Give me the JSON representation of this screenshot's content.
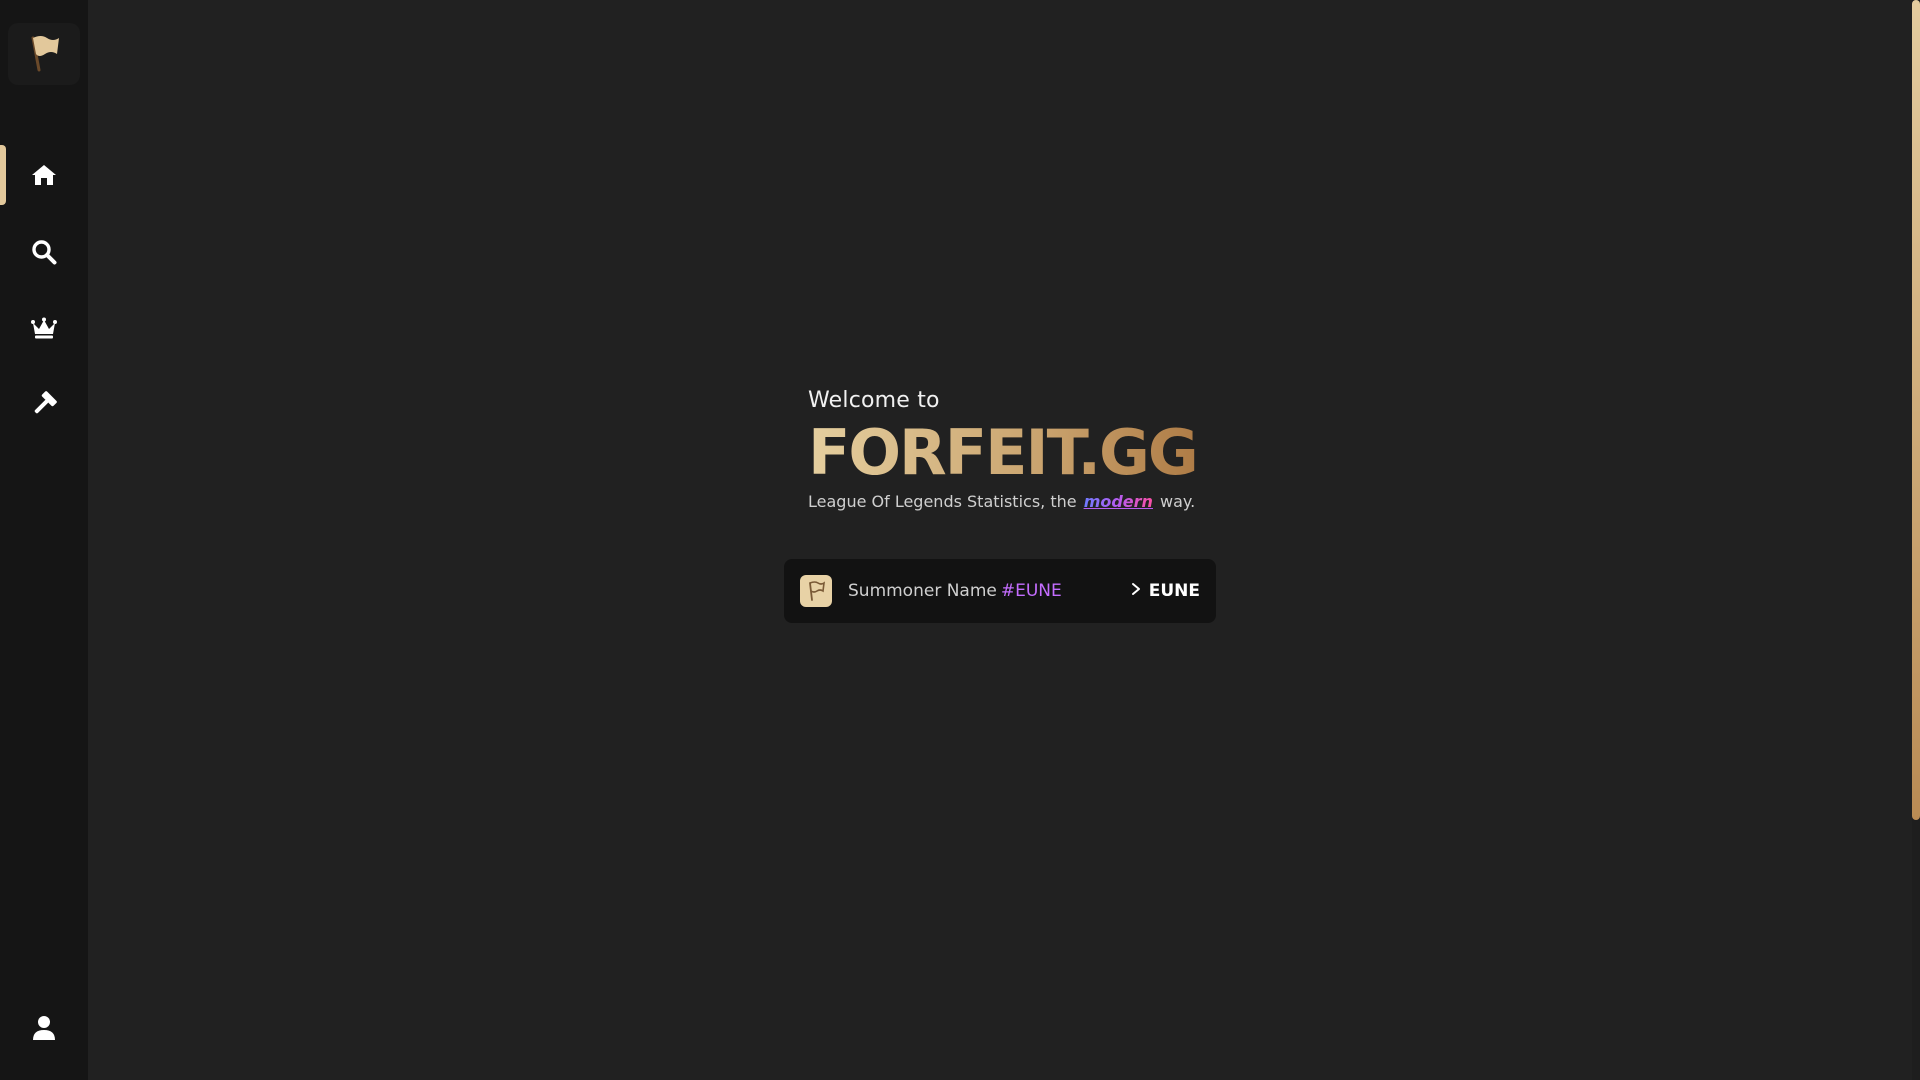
{
  "brand": {
    "welcome": "Welcome to",
    "name": "FORFEIT.GG",
    "tagline_before": "League Of Legends Statistics, the",
    "tagline_highlight": "modern",
    "tagline_after": "way."
  },
  "sidebar": {
    "logo_icon": "flag-icon",
    "items": [
      {
        "name": "home",
        "icon": "home-icon",
        "active": true
      },
      {
        "name": "search",
        "icon": "search-icon",
        "active": false
      },
      {
        "name": "leaderboard",
        "icon": "crown-icon",
        "active": false
      },
      {
        "name": "tools",
        "icon": "hammer-icon",
        "active": false
      }
    ],
    "bottom_item": {
      "name": "profile",
      "icon": "user-icon"
    }
  },
  "search": {
    "placeholder_name": "Summoner Name",
    "placeholder_tag": "#EUNE",
    "region": "EUNE",
    "avatar_icon": "flag-outline-icon"
  },
  "colors": {
    "background": "#212121",
    "sidebar": "#151515",
    "accent_gold": "#e2c89b",
    "accent_purple": "#c46dff"
  }
}
